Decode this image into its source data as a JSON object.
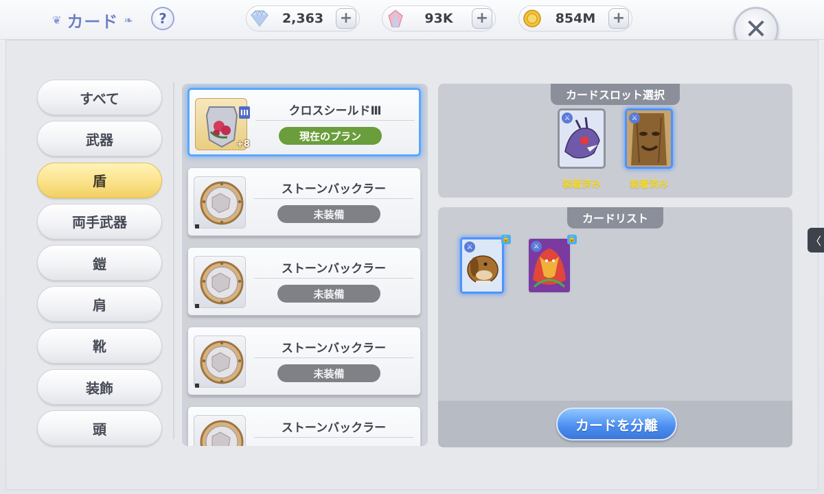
{
  "header": {
    "title": "カード",
    "help_label": "?",
    "currencies": [
      {
        "name": "diamond",
        "value": "2,363",
        "icon": "diamond-icon"
      },
      {
        "name": "crystal",
        "value": "93K",
        "icon": "crystal-icon"
      },
      {
        "name": "zeny",
        "value": "854M",
        "icon": "coin-icon"
      }
    ],
    "plus_label": "+",
    "close_label": "✕"
  },
  "nav": {
    "items": [
      {
        "label": "すべて",
        "active": false
      },
      {
        "label": "武器",
        "active": false
      },
      {
        "label": "盾",
        "active": true
      },
      {
        "label": "両手武器",
        "active": false
      },
      {
        "label": "鎧",
        "active": false
      },
      {
        "label": "肩",
        "active": false
      },
      {
        "label": "靴",
        "active": false
      },
      {
        "label": "装飾",
        "active": false
      },
      {
        "label": "頭",
        "active": false
      }
    ]
  },
  "equipment": {
    "items": [
      {
        "name": "クロスシールドⅢ",
        "status": "現在のプラン",
        "refine": "+8",
        "tier": "III",
        "selected": true
      },
      {
        "name": "ストーンバックラー",
        "status": "未装備",
        "selected": false
      },
      {
        "name": "ストーンバックラー",
        "status": "未装備",
        "selected": false
      },
      {
        "name": "ストーンバックラー",
        "status": "未装備",
        "selected": false
      },
      {
        "name": "ストーンバックラー",
        "status": "",
        "selected": false
      }
    ]
  },
  "card_slot": {
    "title": "カードスロット選択",
    "slots": [
      {
        "label": "装着済み",
        "card": "purple-monster-card",
        "selected": false
      },
      {
        "label": "装着済み",
        "card": "tree-monster-card",
        "selected": true
      }
    ]
  },
  "card_list": {
    "title": "カードリスト",
    "cards": [
      {
        "card": "dog-monster-card",
        "selected": true,
        "locked": true
      },
      {
        "card": "red-dragon-card",
        "selected": false,
        "locked": true
      }
    ],
    "detach_label": "カードを分離"
  },
  "side_tab": {
    "label": "〈"
  },
  "colors": {
    "accent_blue": "#4c93ff",
    "active_nav": "#fbe28a",
    "current_plan": "#6a9d3b",
    "unequipped": "#7f8187",
    "equipped_label": "#f5d829"
  }
}
